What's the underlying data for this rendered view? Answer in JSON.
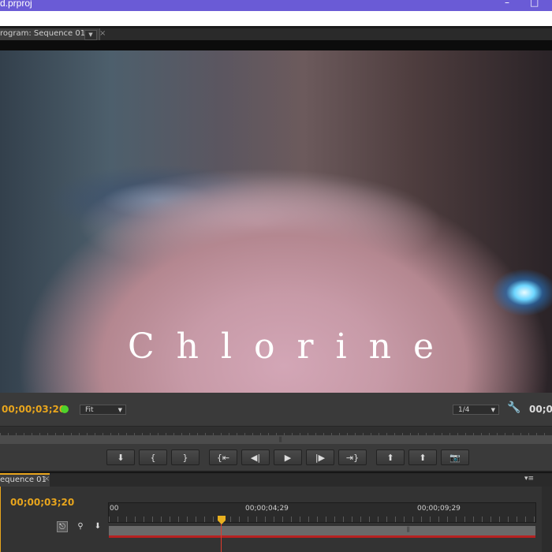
{
  "window": {
    "title": "d.prproj",
    "controls": [
      "–",
      "□"
    ]
  },
  "program_panel": {
    "tab_label": "rogram: Sequence 01",
    "tab_dropdown": "▼",
    "tab_close": "×"
  },
  "video": {
    "overlay_title": "Chlorine"
  },
  "monitor_controls": {
    "timecode": "00;00;03;20",
    "zoom_select": "Fit",
    "resolution_select": "1/4",
    "duration_timecode": "00;0"
  },
  "transport_buttons": [
    {
      "name": "add-marker-button",
      "glyph": "⬇"
    },
    {
      "name": "mark-in-button",
      "glyph": "{"
    },
    {
      "name": "mark-out-button",
      "glyph": "}"
    },
    {
      "name": "go-to-in-button",
      "glyph": "{⇤"
    },
    {
      "name": "step-back-button",
      "glyph": "◀|"
    },
    {
      "name": "play-button",
      "glyph": "▶"
    },
    {
      "name": "step-forward-button",
      "glyph": "|▶"
    },
    {
      "name": "go-to-out-button",
      "glyph": "⇥}"
    },
    {
      "name": "lift-button",
      "glyph": "⬆"
    },
    {
      "name": "extract-button",
      "glyph": "⬆"
    },
    {
      "name": "export-frame-button",
      "glyph": "📷"
    }
  ],
  "timeline_panel": {
    "tab_label": "equence 01",
    "tab_close": "×",
    "panel_menu": "▾≡",
    "timecode": "00;00;03;20",
    "ruler_labels": [
      "00",
      "00;00;04;29",
      "00;00;09;29"
    ]
  },
  "colors": {
    "accent": "#e8a51d",
    "titlebar": "#6a5bd6",
    "status_green": "#4fd32b",
    "playhead": "#e03b2d"
  }
}
